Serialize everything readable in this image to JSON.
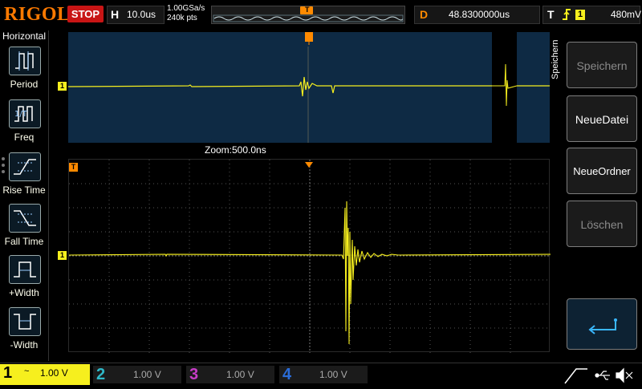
{
  "brand": "RIGOL",
  "run_state": "STOP",
  "timebase": {
    "label": "H",
    "value": "10.0us"
  },
  "sampling": {
    "rate": "1.00GSa/s",
    "points": "240k pts"
  },
  "trigger_pos_marker": "T",
  "delay": {
    "label": "D",
    "value": "48.8300000us"
  },
  "trigger": {
    "label": "T",
    "source": "1",
    "level": "480mV"
  },
  "left_menu": {
    "title": "Horizontal",
    "items": [
      {
        "label": "Period"
      },
      {
        "label": "Freq"
      },
      {
        "label": "Rise Time"
      },
      {
        "label": "Fall Time"
      },
      {
        "label": "+Width"
      },
      {
        "label": "-Width"
      }
    ]
  },
  "zoom_label": "Zoom:500.0ns",
  "channel_marker": "1",
  "trigger_level_marker": "T",
  "right_menu": {
    "title": "Speichern",
    "items": [
      {
        "label": "Speichern",
        "enabled": false
      },
      {
        "label": "NeueDatei",
        "enabled": true
      },
      {
        "label": "NeueOrdner",
        "enabled": true
      },
      {
        "label": "Löschen",
        "enabled": false
      }
    ]
  },
  "channels": [
    {
      "num": "1",
      "coupling": "~",
      "scale": "1.00 V",
      "active": true,
      "color": "#f6ef1e"
    },
    {
      "num": "2",
      "coupling": "",
      "scale": "1.00 V",
      "active": false,
      "color": "#2fb8c8"
    },
    {
      "num": "3",
      "coupling": "",
      "scale": "1.00 V",
      "active": false,
      "color": "#c83cc8"
    },
    {
      "num": "4",
      "coupling": "",
      "scale": "1.00 V",
      "active": false,
      "color": "#2a6cd8"
    }
  ],
  "colors": {
    "trace": "#f6ef1e",
    "accent": "#ff8a00",
    "stop": "#c81515",
    "zoom_bg": "#0e2a44"
  }
}
